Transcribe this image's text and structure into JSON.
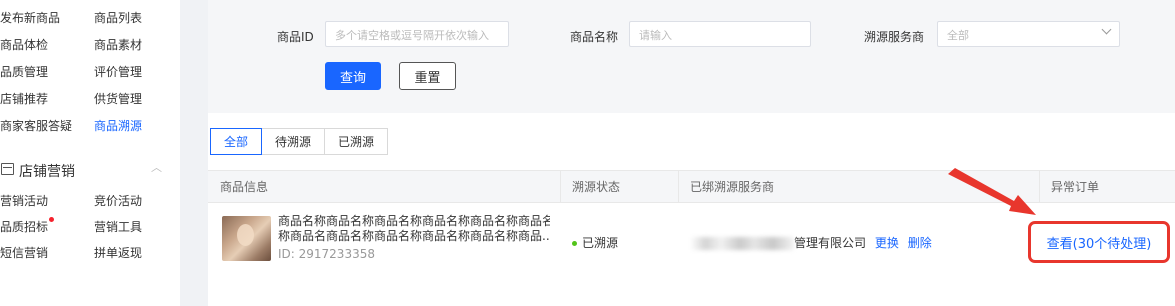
{
  "sidebar": {
    "rows_top": [
      {
        "left": "发布新商品",
        "right": "商品列表"
      },
      {
        "left": "商品体检",
        "right": "商品素材"
      },
      {
        "left": "品质管理",
        "right": "评价管理"
      },
      {
        "left": "店铺推荐",
        "right": "供货管理"
      },
      {
        "left": "商家客服答疑",
        "right": "商品溯源"
      }
    ],
    "section_title": "店铺营销",
    "rows_bottom": [
      {
        "left": "营销活动",
        "right": "竞价活动"
      },
      {
        "left": "品质招标",
        "right": "营销工具"
      },
      {
        "left": "短信营销",
        "right": "拼单返现"
      }
    ]
  },
  "filters": {
    "product_id_label": "商品ID",
    "product_id_placeholder": "多个请空格或逗号隔开依次输入",
    "product_name_label": "商品名称",
    "product_name_placeholder": "请输入",
    "provider_label": "溯源服务商",
    "provider_value": "全部",
    "search_label": "查询",
    "reset_label": "重置"
  },
  "tabs": [
    "全部",
    "待溯源",
    "已溯源"
  ],
  "table": {
    "headers": [
      "商品信息",
      "溯源状态",
      "已绑溯源服务商",
      "异常订单"
    ],
    "row": {
      "name_line1": "商品名称商品名称商品名称商品名称商品名称商品名",
      "name_line2": "称商品名商品名称商品名称商品名称商品名称商品...",
      "id": "ID: 2917233358",
      "status": "已溯源",
      "provider_visible": "管理有限公司",
      "change_label": "更换",
      "delete_label": "删除",
      "abnormal_orders": "查看(30个待处理)"
    }
  },
  "colors": {
    "accent": "#1966ff",
    "highlight": "#e8362d",
    "success": "#52c41a"
  }
}
